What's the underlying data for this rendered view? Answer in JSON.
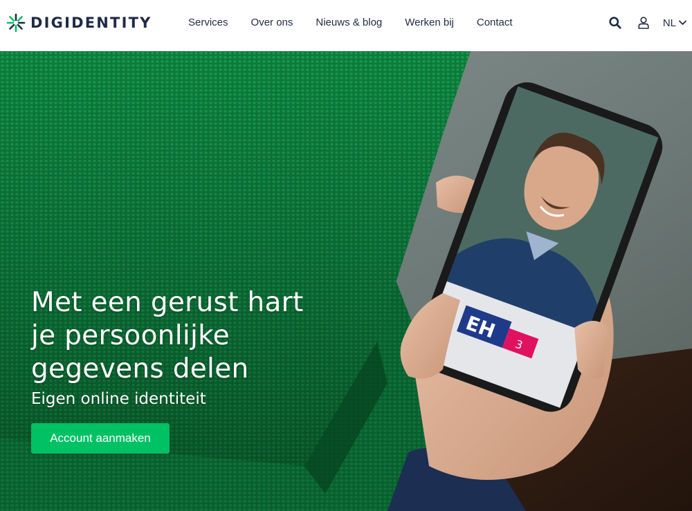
{
  "brand": {
    "name": "DIGIDENTITY",
    "accent": "#00c164",
    "navy": "#1f2a44"
  },
  "nav": {
    "items": [
      {
        "label": "Services"
      },
      {
        "label": "Over ons"
      },
      {
        "label": "Nieuws & blog"
      },
      {
        "label": "Werken bij"
      },
      {
        "label": "Contact"
      }
    ]
  },
  "tools": {
    "search_icon": "search-icon",
    "account_icon": "user-icon",
    "language": "NL"
  },
  "hero": {
    "title": "Met een gerust hart je persoonlijke gegevens delen",
    "subtitle": "Eigen online identiteit",
    "cta_label": "Account aanmaken",
    "phone_app_logo": {
      "letters": "EH",
      "badge": "3"
    }
  }
}
